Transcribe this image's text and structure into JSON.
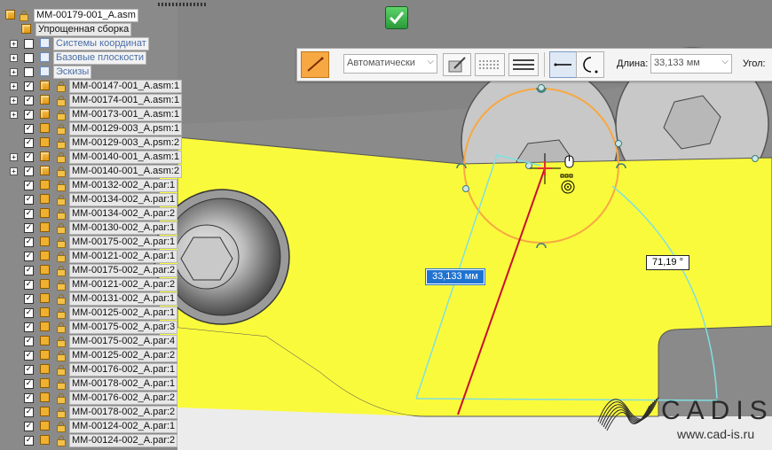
{
  "app": {
    "accent_orange": "#f7a843",
    "selection_blue": "#1f73d0",
    "part_yellow": "#fafa3c"
  },
  "tree": {
    "root": {
      "label": "MM-00179-001_A.asm",
      "icon": "assembly-icon"
    },
    "simplified": {
      "label": "Упрощенная сборка",
      "icon": "simplified-assembly-icon"
    },
    "groups": [
      {
        "label": "Системы координат",
        "icon": "coordinate-system-icon",
        "checked": false
      },
      {
        "label": "Базовые плоскости",
        "icon": "reference-plane-icon",
        "checked": false
      },
      {
        "label": "Эскизы",
        "icon": "sketch-icon",
        "checked": false
      }
    ],
    "items": [
      {
        "label": "MM-00147-001_A.asm:1",
        "type": "asm",
        "expandable": true
      },
      {
        "label": "MM-00174-001_A.asm:1",
        "type": "asm",
        "expandable": true
      },
      {
        "label": "MM-00173-001_A.asm:1",
        "type": "asm",
        "expandable": true
      },
      {
        "label": "MM-00129-003_A.psm:1",
        "type": "psm",
        "expandable": false
      },
      {
        "label": "MM-00129-003_A.psm:2",
        "type": "psm",
        "expandable": false
      },
      {
        "label": "MM-00140-001_A.asm:1",
        "type": "asm",
        "expandable": true
      },
      {
        "label": "MM-00140-001_A.asm:2",
        "type": "asm",
        "expandable": true
      },
      {
        "label": "MM-00132-002_A.par:1",
        "type": "par",
        "expandable": false
      },
      {
        "label": "MM-00134-002_A.par:1",
        "type": "par",
        "expandable": false
      },
      {
        "label": "MM-00134-002_A.par:2",
        "type": "par",
        "expandable": false
      },
      {
        "label": "MM-00130-002_A.par:1",
        "type": "par",
        "expandable": false
      },
      {
        "label": "MM-00175-002_A.par:1",
        "type": "par",
        "expandable": false
      },
      {
        "label": "MM-00121-002_A.par:1",
        "type": "par",
        "expandable": false
      },
      {
        "label": "MM-00175-002_A.par:2",
        "type": "par",
        "expandable": false
      },
      {
        "label": "MM-00121-002_A.par:2",
        "type": "par",
        "expandable": false
      },
      {
        "label": "MM-00131-002_A.par:1",
        "type": "par",
        "expandable": false
      },
      {
        "label": "MM-00125-002_A.par:1",
        "type": "par",
        "expandable": false
      },
      {
        "label": "MM-00175-002_A.par:3",
        "type": "par",
        "expandable": false
      },
      {
        "label": "MM-00175-002_A.par:4",
        "type": "par",
        "expandable": false
      },
      {
        "label": "MM-00125-002_A.par:2",
        "type": "par",
        "expandable": false
      },
      {
        "label": "MM-00176-002_A.par:1",
        "type": "par",
        "expandable": false
      },
      {
        "label": "MM-00178-002_A.par:1",
        "type": "par",
        "expandable": false
      },
      {
        "label": "MM-00176-002_A.par:2",
        "type": "par",
        "expandable": false
      },
      {
        "label": "MM-00178-002_A.par:2",
        "type": "par",
        "expandable": false
      },
      {
        "label": "MM-00124-002_A.par:1",
        "type": "par",
        "expandable": false
      },
      {
        "label": "MM-00124-002_A.par:2",
        "type": "par",
        "expandable": false
      }
    ]
  },
  "toolbar": {
    "line_tool_icon": "line-tool-icon",
    "mode_select": "Автоматически",
    "length_label": "Длина:",
    "length_value": "33,133 мм",
    "angle_label": "Угол:"
  },
  "canvas": {
    "dim_length": "33,133 мм",
    "dim_angle": "71,19 °"
  },
  "accept_icon": "accept-check-icon",
  "logo": {
    "name": "CADIS",
    "url": "www.cad-is.ru"
  }
}
